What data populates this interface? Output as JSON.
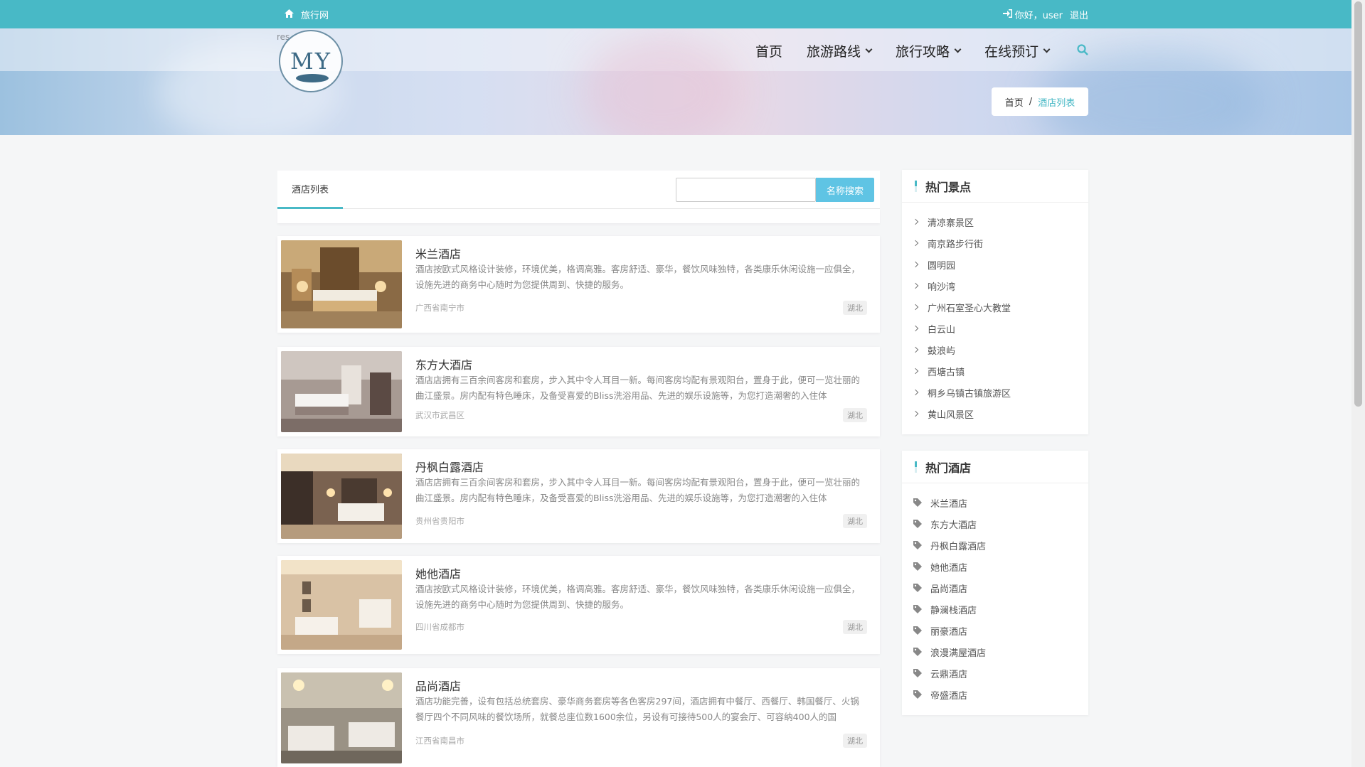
{
  "topbar": {
    "site_name": "旅行网",
    "greeting": "你好，user",
    "logout": "退出"
  },
  "logo": {
    "text": "MY",
    "alt_text": "res"
  },
  "nav": {
    "items": [
      {
        "label": "首页"
      },
      {
        "label": "旅游路线"
      },
      {
        "label": "旅行攻略"
      },
      {
        "label": "在线预订"
      }
    ]
  },
  "breadcrumb": {
    "home": "首页",
    "separator": "/",
    "current": "酒店列表"
  },
  "list": {
    "tab": "酒店列表",
    "search_placeholder": "",
    "search_button": "名称搜索",
    "hotels": [
      {
        "name": "米兰酒店",
        "desc": "酒店按欧式风格设计装修，环境优美，格调高雅。客房舒适、豪华，餐饮风味独特，各类康乐休闲设施一应俱全，设施先进的商务中心随时为您提供周到、快捷的服务。",
        "address": "广西省南宁市",
        "tag": "湖北"
      },
      {
        "name": "东方大酒店",
        "desc": "酒店店拥有三百余间客房和套房，步入其中令人耳目一新。每间客房均配有景观阳台，置身于此，便可一览壮丽的曲江盛景。房内配有特色睡床，及备受喜爱的Bliss洗浴用品、先进的娱乐设施等，为您打造潮奢的入住体",
        "address": "武汉市武昌区",
        "tag": "湖北"
      },
      {
        "name": "丹枫白露酒店",
        "desc": "酒店店拥有三百余间客房和套房，步入其中令人耳目一新。每间客房均配有景观阳台，置身于此，便可一览壮丽的曲江盛景。房内配有特色睡床，及备受喜爱的Bliss洗浴用品、先进的娱乐设施等，为您打造潮奢的入住体",
        "address": "贵州省贵阳市",
        "tag": "湖北"
      },
      {
        "name": "她他酒店",
        "desc": "酒店按欧式风格设计装修，环境优美，格调高雅。客房舒适、豪华，餐饮风味独特，各类康乐休闲设施一应俱全，设施先进的商务中心随时为您提供周到、快捷的服务。",
        "address": "四川省成都市",
        "tag": "湖北"
      },
      {
        "name": "品尚酒店",
        "desc": "酒店功能完善，设有包括总统套房、豪华商务套房等各色客房297间，酒店拥有中餐厅、西餐厅、韩国餐厅、火锅餐厅四个不同风味的餐饮场所，就餐总座位数1600余位，另设有可接待500人的宴会厅、可容纳400人的国",
        "address": "江西省南昌市",
        "tag": "湖北"
      }
    ]
  },
  "sidebar": {
    "attractions_title": "热门景点",
    "attractions": [
      "清凉寨景区",
      "南京路步行街",
      "圆明园",
      "响沙湾",
      "广州石室圣心大教堂",
      "白云山",
      "鼓浪屿",
      "西塘古镇",
      "桐乡乌镇古镇旅游区",
      "黄山风景区"
    ],
    "hotels_title": "热门酒店",
    "hotels": [
      "米兰酒店",
      "东方大酒店",
      "丹枫白露酒店",
      "她他酒店",
      "品尚酒店",
      "静澜栈酒店",
      "丽豪酒店",
      "浪漫满屋酒店",
      "云鼎酒店",
      "帝盛酒店"
    ]
  },
  "colors": {
    "accent": "#48b9c6",
    "search_button": "#5fc4e4"
  }
}
